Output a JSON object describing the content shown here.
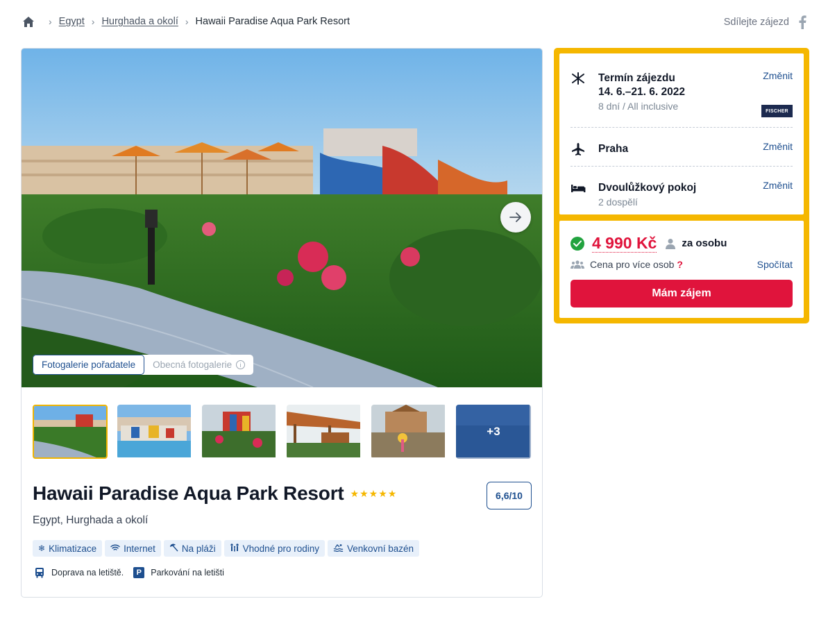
{
  "breadcrumb": {
    "items": [
      "Egypt",
      "Hurghada a okolí"
    ],
    "current": "Hawaii Paradise Aqua Park Resort"
  },
  "share": {
    "label": "Sdílejte zájezd"
  },
  "gallery": {
    "tabs": [
      "Fotogalerie pořadatele",
      "Obecná fotogalerie"
    ],
    "more_count": "+3"
  },
  "hotel": {
    "name": "Hawaii Paradise Aqua Park Resort",
    "stars": "★★★★★",
    "rating": "6,6/10",
    "location": "Egypt, Hurghada a okolí"
  },
  "tags": [
    {
      "icon": "snowflake-icon",
      "label": "Klimatizace"
    },
    {
      "icon": "wifi-icon",
      "label": "Internet"
    },
    {
      "icon": "beach-umbrella-icon",
      "label": "Na pláži"
    },
    {
      "icon": "family-icon",
      "label": "Vhodné pro rodiny"
    },
    {
      "icon": "pool-icon",
      "label": "Venkovní bazén"
    }
  ],
  "services": [
    {
      "icon": "bus-icon",
      "label": "Doprava na letiště."
    },
    {
      "icon": "parking-icon",
      "label": "Parkování na letišti"
    }
  ],
  "booking": {
    "term_title": "Termín zájezdu",
    "term_dates": "14. 6.–21. 6. 2022",
    "term_sub": "8 dní / All inclusive",
    "operator_logo": "FISCHER",
    "departure": "Praha",
    "room": "Dvoulůžkový pokoj",
    "room_sub": "2 dospělí",
    "change": "Změnit",
    "price": "4 990 Kč",
    "per_person": "za osobu",
    "multi_label": "Cena pro více osob",
    "multi_q": "?",
    "calc": "Spočítat",
    "cta": "Mám zájem"
  },
  "colors": {
    "accent": "#f5b700",
    "price": "#e0143c",
    "link": "#1e4f8f",
    "check": "#22a33f"
  }
}
